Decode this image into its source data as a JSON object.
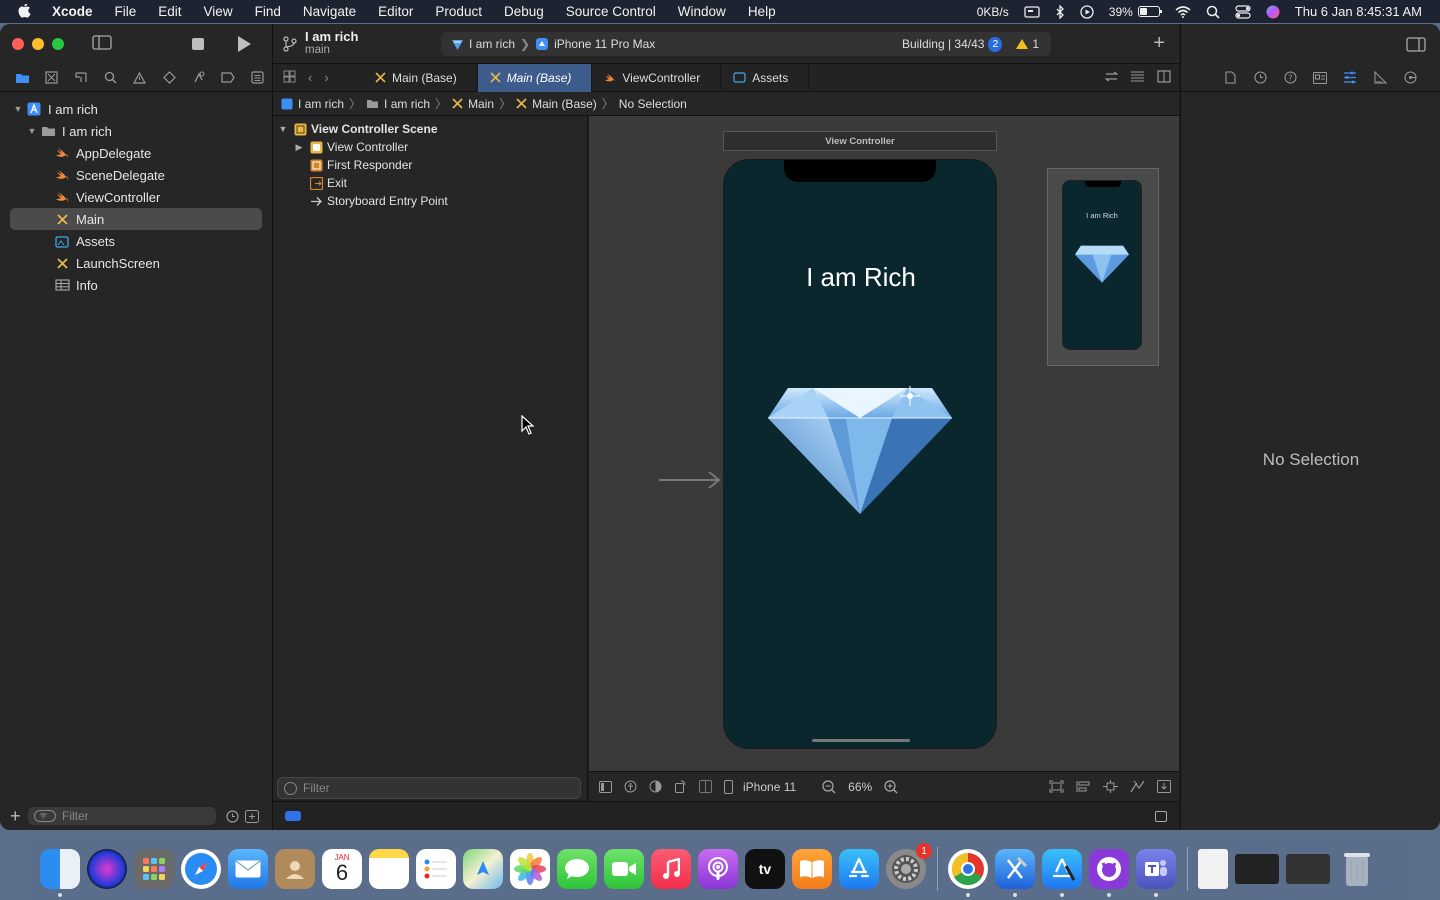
{
  "menubar": {
    "app_name": "Xcode",
    "items": [
      "File",
      "Edit",
      "View",
      "Find",
      "Navigate",
      "Editor",
      "Product",
      "Debug",
      "Source Control",
      "Window",
      "Help"
    ],
    "network": "0KB/s",
    "battery": "39%",
    "clock": "Thu 6 Jan  8:45:31 AM"
  },
  "toolbar": {
    "project": "I am rich",
    "branch": "main",
    "scheme": "I am rich",
    "device": "iPhone 11 Pro Max",
    "status": "Building | 34/43",
    "issue_count": "2",
    "warning_count": "1"
  },
  "navigator": {
    "root": "I am rich",
    "group": "I am rich",
    "files": [
      "AppDelegate",
      "SceneDelegate",
      "ViewController",
      "Main",
      "Assets",
      "LaunchScreen",
      "Info"
    ],
    "selected": "Main",
    "filter_placeholder": "Filter"
  },
  "tabs": [
    {
      "label": "Main (Base)",
      "active": false
    },
    {
      "label": "Main (Base)",
      "active": true
    },
    {
      "label": "ViewController",
      "active": false
    },
    {
      "label": "Assets",
      "active": false
    }
  ],
  "jumpbar": [
    "I am rich",
    "I am rich",
    "Main",
    "Main (Base)",
    "No Selection"
  ],
  "outline": {
    "scene": "View Controller Scene",
    "items": [
      "View Controller",
      "First Responder",
      "Exit",
      "Storyboard Entry Point"
    ],
    "filter_placeholder": "Filter"
  },
  "canvas": {
    "scene_title": "View Controller",
    "label_text": "I am Rich",
    "minimap_label": "I am Rich",
    "device": "iPhone 11",
    "zoom": "66%"
  },
  "inspector": {
    "empty_text": "No Selection"
  },
  "dock": {
    "settings_badge": "1",
    "calendar_month": "JAN",
    "calendar_day": "6"
  },
  "colors": {
    "accent": "#2e74e8",
    "selected_tab": "#3d5c8c",
    "phone_bg": "#0a272d"
  }
}
